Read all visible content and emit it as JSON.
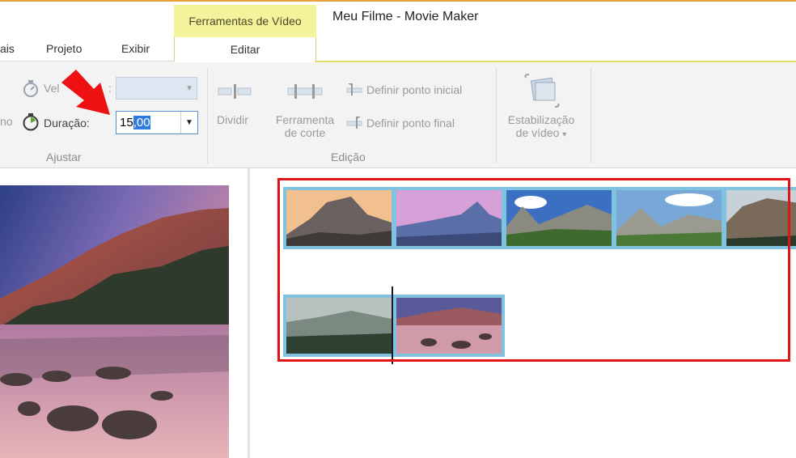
{
  "window": {
    "title": "Meu Filme - Movie Maker",
    "context_tab": "Ferramentas de Vídeo"
  },
  "tabs": [
    {
      "label": "ais"
    },
    {
      "label": "Projeto"
    },
    {
      "label": "Exibir"
    },
    {
      "label": "Editar",
      "active": true
    }
  ],
  "ribbon": {
    "adjust": {
      "partial_left_top": "",
      "partial_left_bottom": "no",
      "speed_label_left": "Vel",
      "speed_label_right": ":",
      "speed_value": "",
      "duration_label": "Duração:",
      "duration_value_plain": "15",
      "duration_value_selected": ",00",
      "group_label": "Ajustar"
    },
    "edit": {
      "split_label": "Dividir",
      "trim_tool_line1": "Ferramenta",
      "trim_tool_line2": "de corte",
      "set_start": "Definir ponto inicial",
      "set_end": "Definir ponto final",
      "group_label": "Edição"
    },
    "stabilize": {
      "line1": "Estabilização",
      "line2": "de vídeo",
      "dropdown": "▾"
    }
  },
  "storyboard": {
    "clips": [
      {
        "scene": "half-dome-sunset"
      },
      {
        "scene": "half-dome-pink"
      },
      {
        "scene": "valley-green"
      },
      {
        "scene": "valley-green-2"
      },
      {
        "scene": "el-capitan-mist"
      },
      {
        "scene": "misty-forest"
      },
      {
        "scene": "lake-rocks-sunset"
      }
    ]
  },
  "colors": {
    "context_tab": "#f4f29a",
    "highlight": "#e01414",
    "clip_border": "#7fc3e0",
    "selection": "#2f7be0"
  }
}
